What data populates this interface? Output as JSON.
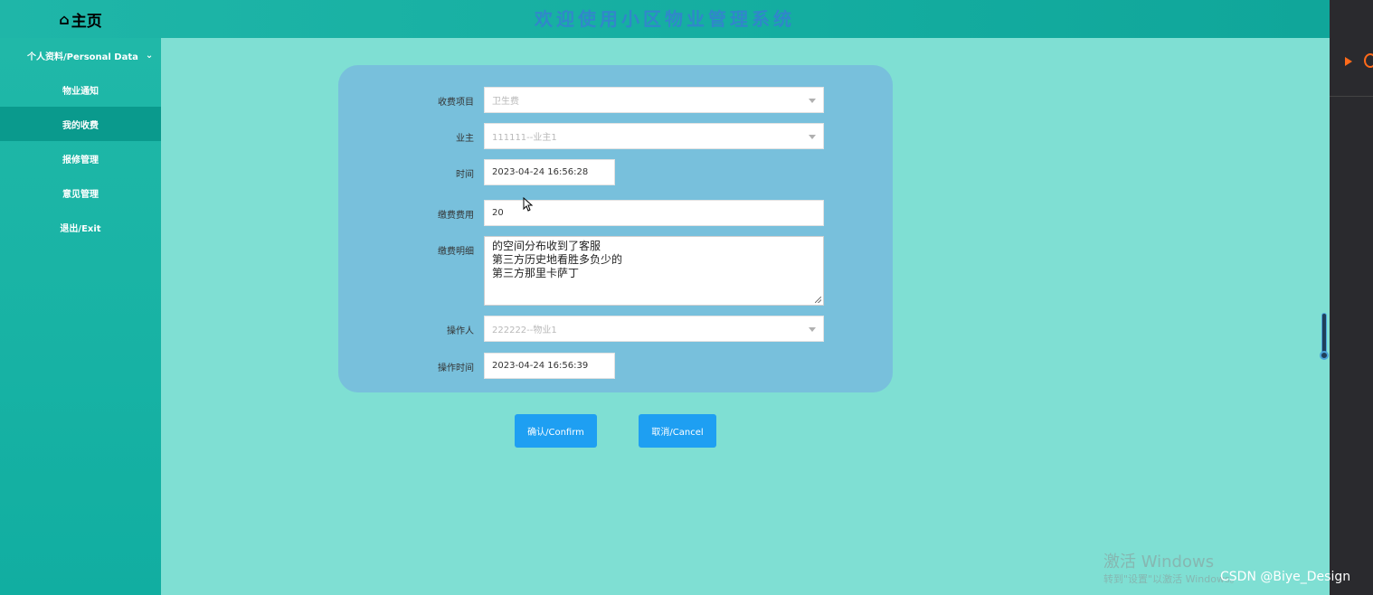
{
  "header": {
    "home_icon": "⌂",
    "home_label": "主页",
    "banner": "欢迎使用小区物业管理系统"
  },
  "sidebar": {
    "group_label": "个人资料/Personal Data",
    "items": [
      {
        "label": "物业通知"
      },
      {
        "label": "我的收费"
      },
      {
        "label": "报修管理"
      },
      {
        "label": "意见管理"
      },
      {
        "label": "退出/Exit"
      }
    ]
  },
  "form": {
    "charge_item": {
      "label": "收费项目",
      "value": "卫生费"
    },
    "owner": {
      "label": "业主",
      "value": "111111--业主1"
    },
    "time": {
      "label": "时间",
      "value": "2023-04-24 16:56:28"
    },
    "fee": {
      "label": "缴费费用",
      "value": "20"
    },
    "detail": {
      "label": "缴费明细",
      "lines": [
        "的空间分布收到了客服",
        "第三方历史地看胜多负少的",
        "第三方那里卡萨丁"
      ]
    },
    "operator": {
      "label": "操作人",
      "value": "222222--物业1"
    },
    "op_time": {
      "label": "操作时间",
      "value": "2023-04-24 16:56:39"
    }
  },
  "buttons": {
    "confirm": "确认/Confirm",
    "cancel": "取消/Cancel"
  },
  "overlay": {
    "windows_title": "激活 Windows",
    "windows_sub": "转到\"设置\"以激活 Windows。",
    "csdn": "CSDN @Biye_Design"
  }
}
